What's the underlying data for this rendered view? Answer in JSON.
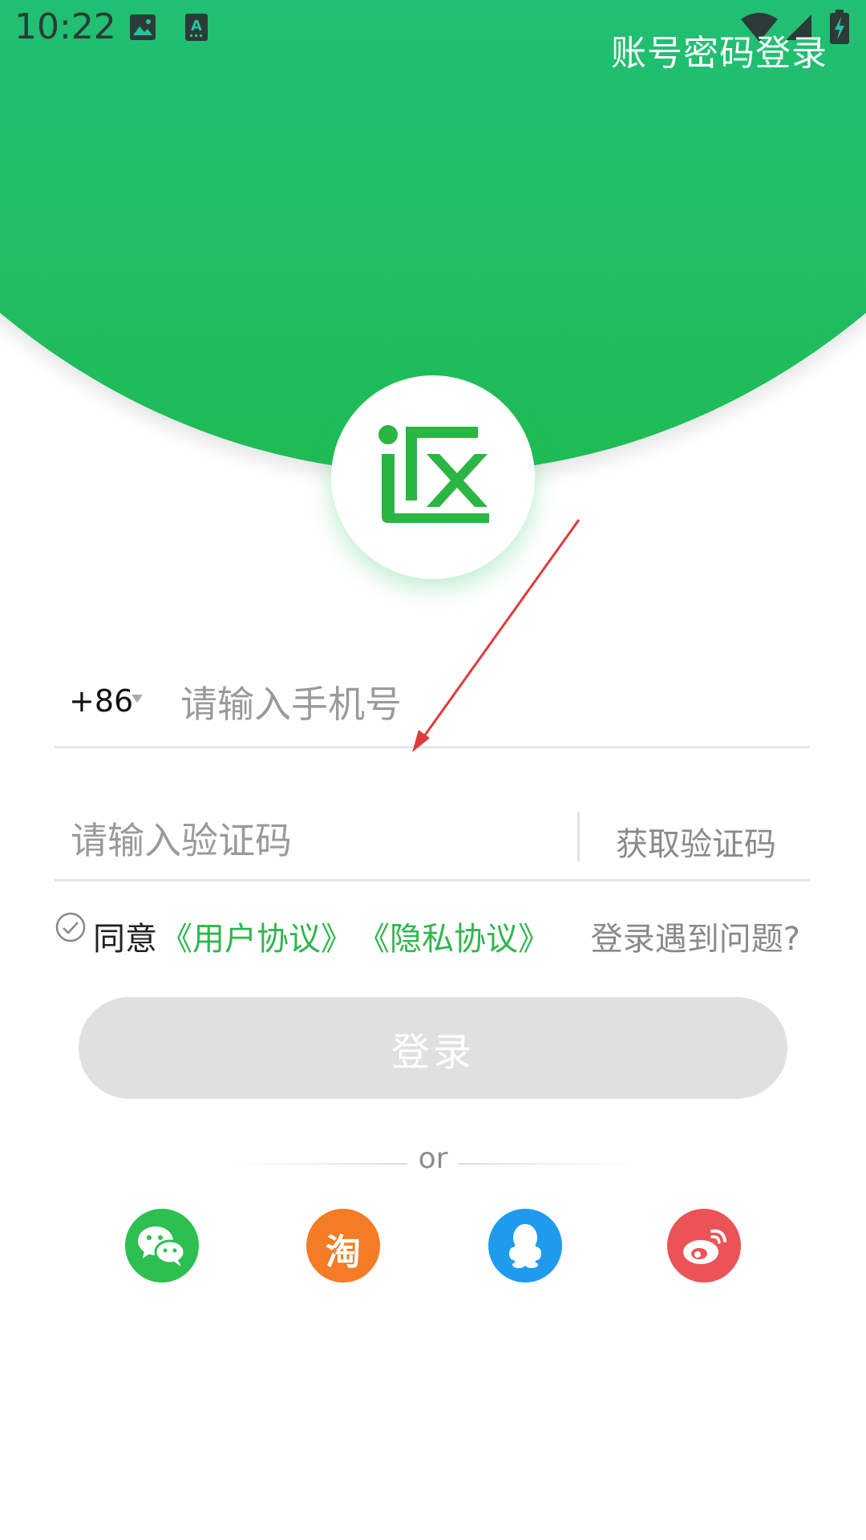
{
  "status_bar": {
    "time": "10:22"
  },
  "header": {
    "account_password_login": "账号密码登录"
  },
  "logo": {
    "icon": "fan-logo-icon"
  },
  "form": {
    "country_code": "+86",
    "phone_placeholder": "请输入手机号",
    "phone_value": "",
    "code_placeholder": "请输入验证码",
    "code_value": "",
    "get_code_label": "获取验证码"
  },
  "agreement": {
    "agree_label": "同意",
    "user_agreement": "《用户协议》",
    "privacy_agreement": "《隐私协议》",
    "help_link": "登录遇到问题?"
  },
  "login_button": "登录",
  "divider_text": "or",
  "social_logins": [
    {
      "icon": "wechat-icon",
      "color": "#2dbf50"
    },
    {
      "icon": "taobao-icon",
      "label": "淘",
      "color": "#f47c26"
    },
    {
      "icon": "qq-icon",
      "color": "#1e9bed"
    },
    {
      "icon": "weibo-icon",
      "color": "#eb5356"
    }
  ],
  "colors": {
    "header_top": "#22c3a0",
    "header_bottom": "#1fbb55",
    "accent_green": "#2fb64e",
    "disabled_button": "#e0e0e0",
    "annotation_arrow": "#e03a3a"
  }
}
